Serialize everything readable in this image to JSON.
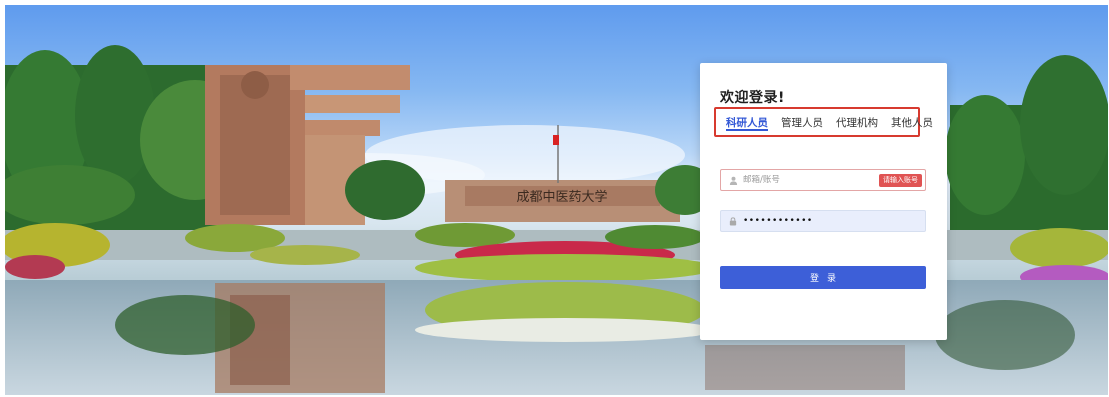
{
  "scene": {
    "gate_sign": "成都中医药大学"
  },
  "login": {
    "welcome": "欢迎登录!",
    "tabs": [
      {
        "label": "科研人员",
        "active": true
      },
      {
        "label": "管理人员",
        "active": false
      },
      {
        "label": "代理机构",
        "active": false
      },
      {
        "label": "其他人员",
        "active": false
      }
    ],
    "username": {
      "placeholder": "邮箱/账号",
      "value": "",
      "error": "请输入账号",
      "icon": "user-icon"
    },
    "password": {
      "value": "••••••••••••",
      "icon": "lock-icon"
    },
    "submit_label": "登录"
  },
  "colors": {
    "accent": "#3d5fd8",
    "highlight_box": "#d73a2f",
    "error": "#e05353"
  }
}
